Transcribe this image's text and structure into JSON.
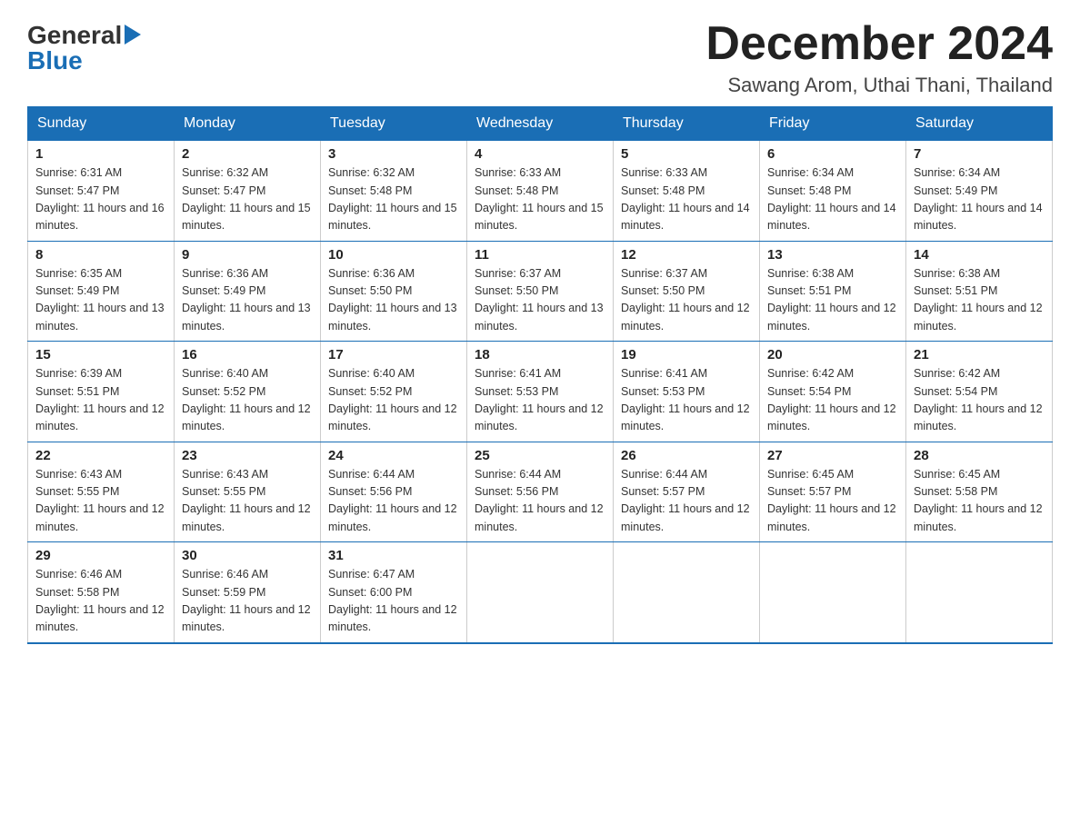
{
  "header": {
    "logo_general": "General",
    "logo_blue": "Blue",
    "month_title": "December 2024",
    "subtitle": "Sawang Arom, Uthai Thani, Thailand"
  },
  "days_of_week": [
    "Sunday",
    "Monday",
    "Tuesday",
    "Wednesday",
    "Thursday",
    "Friday",
    "Saturday"
  ],
  "weeks": [
    [
      {
        "day": "1",
        "sunrise": "6:31 AM",
        "sunset": "5:47 PM",
        "daylight": "11 hours and 16 minutes."
      },
      {
        "day": "2",
        "sunrise": "6:32 AM",
        "sunset": "5:47 PM",
        "daylight": "11 hours and 15 minutes."
      },
      {
        "day": "3",
        "sunrise": "6:32 AM",
        "sunset": "5:48 PM",
        "daylight": "11 hours and 15 minutes."
      },
      {
        "day": "4",
        "sunrise": "6:33 AM",
        "sunset": "5:48 PM",
        "daylight": "11 hours and 15 minutes."
      },
      {
        "day": "5",
        "sunrise": "6:33 AM",
        "sunset": "5:48 PM",
        "daylight": "11 hours and 14 minutes."
      },
      {
        "day": "6",
        "sunrise": "6:34 AM",
        "sunset": "5:48 PM",
        "daylight": "11 hours and 14 minutes."
      },
      {
        "day": "7",
        "sunrise": "6:34 AM",
        "sunset": "5:49 PM",
        "daylight": "11 hours and 14 minutes."
      }
    ],
    [
      {
        "day": "8",
        "sunrise": "6:35 AM",
        "sunset": "5:49 PM",
        "daylight": "11 hours and 13 minutes."
      },
      {
        "day": "9",
        "sunrise": "6:36 AM",
        "sunset": "5:49 PM",
        "daylight": "11 hours and 13 minutes."
      },
      {
        "day": "10",
        "sunrise": "6:36 AM",
        "sunset": "5:50 PM",
        "daylight": "11 hours and 13 minutes."
      },
      {
        "day": "11",
        "sunrise": "6:37 AM",
        "sunset": "5:50 PM",
        "daylight": "11 hours and 13 minutes."
      },
      {
        "day": "12",
        "sunrise": "6:37 AM",
        "sunset": "5:50 PM",
        "daylight": "11 hours and 12 minutes."
      },
      {
        "day": "13",
        "sunrise": "6:38 AM",
        "sunset": "5:51 PM",
        "daylight": "11 hours and 12 minutes."
      },
      {
        "day": "14",
        "sunrise": "6:38 AM",
        "sunset": "5:51 PM",
        "daylight": "11 hours and 12 minutes."
      }
    ],
    [
      {
        "day": "15",
        "sunrise": "6:39 AM",
        "sunset": "5:51 PM",
        "daylight": "11 hours and 12 minutes."
      },
      {
        "day": "16",
        "sunrise": "6:40 AM",
        "sunset": "5:52 PM",
        "daylight": "11 hours and 12 minutes."
      },
      {
        "day": "17",
        "sunrise": "6:40 AM",
        "sunset": "5:52 PM",
        "daylight": "11 hours and 12 minutes."
      },
      {
        "day": "18",
        "sunrise": "6:41 AM",
        "sunset": "5:53 PM",
        "daylight": "11 hours and 12 minutes."
      },
      {
        "day": "19",
        "sunrise": "6:41 AM",
        "sunset": "5:53 PM",
        "daylight": "11 hours and 12 minutes."
      },
      {
        "day": "20",
        "sunrise": "6:42 AM",
        "sunset": "5:54 PM",
        "daylight": "11 hours and 12 minutes."
      },
      {
        "day": "21",
        "sunrise": "6:42 AM",
        "sunset": "5:54 PM",
        "daylight": "11 hours and 12 minutes."
      }
    ],
    [
      {
        "day": "22",
        "sunrise": "6:43 AM",
        "sunset": "5:55 PM",
        "daylight": "11 hours and 12 minutes."
      },
      {
        "day": "23",
        "sunrise": "6:43 AM",
        "sunset": "5:55 PM",
        "daylight": "11 hours and 12 minutes."
      },
      {
        "day": "24",
        "sunrise": "6:44 AM",
        "sunset": "5:56 PM",
        "daylight": "11 hours and 12 minutes."
      },
      {
        "day": "25",
        "sunrise": "6:44 AM",
        "sunset": "5:56 PM",
        "daylight": "11 hours and 12 minutes."
      },
      {
        "day": "26",
        "sunrise": "6:44 AM",
        "sunset": "5:57 PM",
        "daylight": "11 hours and 12 minutes."
      },
      {
        "day": "27",
        "sunrise": "6:45 AM",
        "sunset": "5:57 PM",
        "daylight": "11 hours and 12 minutes."
      },
      {
        "day": "28",
        "sunrise": "6:45 AM",
        "sunset": "5:58 PM",
        "daylight": "11 hours and 12 minutes."
      }
    ],
    [
      {
        "day": "29",
        "sunrise": "6:46 AM",
        "sunset": "5:58 PM",
        "daylight": "11 hours and 12 minutes."
      },
      {
        "day": "30",
        "sunrise": "6:46 AM",
        "sunset": "5:59 PM",
        "daylight": "11 hours and 12 minutes."
      },
      {
        "day": "31",
        "sunrise": "6:47 AM",
        "sunset": "6:00 PM",
        "daylight": "11 hours and 12 minutes."
      },
      null,
      null,
      null,
      null
    ]
  ]
}
